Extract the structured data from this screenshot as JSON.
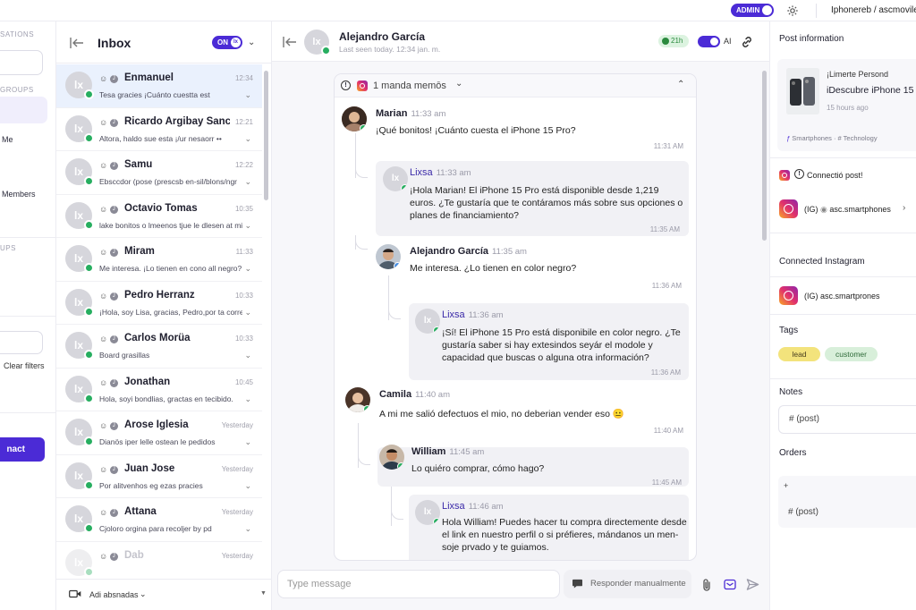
{
  "topbar": {
    "admin_label": "ADMIN",
    "account_label": "Iphonereb / ascmoviles",
    "gear_icon": "gear-icon"
  },
  "leftnav": {
    "section_conversations": "SATIONS",
    "section_groups": "GROUPS",
    "item_me": "Me",
    "item_members": "Members",
    "section_ups": "UPS",
    "clear_filters": "Clear filters",
    "cta_label": "nact"
  },
  "inbox": {
    "title": "Inbox",
    "toggle_label": "ON",
    "toggle_knob": "lx",
    "footer_label": "Adi absnadas",
    "conversations": [
      {
        "name": "Enmanuel",
        "time": "12:34",
        "preview": "Tesa gracies ¡Cuánto cuestta est",
        "active": true
      },
      {
        "name": "Ricardo Argibay Sanc...",
        "time": "12:21",
        "preview": "Altora, haldo sue esta ¡/ur nesaorr ••",
        "active": false
      },
      {
        "name": "Samu",
        "time": "12:22",
        "preview": "Ebsccdor (pose (prescsb en-sil/blons/ngr",
        "active": false
      },
      {
        "name": "Octavio Tomas",
        "time": "10:35",
        "preview": "lake bonitos o lmeenos tjue le dlesen at mi",
        "active": false
      },
      {
        "name": "Miram",
        "time": "11:33",
        "preview": "Me interesa. ¡Lo tienen en cono all negro?",
        "active": false
      },
      {
        "name": "Pedro Herranz",
        "time": "10:33",
        "preview": "¡Hola, soy Lisa, gracias, Pedro,por ta correos'",
        "active": false
      },
      {
        "name": "Carlos Morüa",
        "time": "10:33",
        "preview": "Board grasillas",
        "active": false
      },
      {
        "name": "Jonathan",
        "time": "10:45",
        "preview": "Hola, soyi bondlias, gractas en tecibido.",
        "active": false
      },
      {
        "name": "Arose Iglesia",
        "time": "Yesterday",
        "preview": "Dianös iper lelle ostean le pedidos",
        "active": false
      },
      {
        "name": "Juan Jose",
        "time": "Yesterday",
        "preview": "Por alitvenhos eg ezas pracies",
        "active": false
      },
      {
        "name": "Attana",
        "time": "Yesterday",
        "preview": "Cjoloro orgina para recoljer by pd",
        "active": false
      },
      {
        "name": "Dab",
        "time": "Yesterday",
        "preview": "",
        "active": false
      }
    ]
  },
  "chat": {
    "contact_name": "Alejandro García",
    "last_seen": "Last seen today. 12:34 jan. m.",
    "timer": "21h",
    "ai_label": "AI",
    "thread_title": "1 manda memōs",
    "composer_placeholder": "Type message",
    "manual_label": "Responder manualmente",
    "messages": [
      {
        "author": "Marian",
        "time": "11:33 am",
        "text": "¡Qué bonitos! ¡Cuánto cuesta el iPhone 15 Pro?",
        "footer": "11:31 AM"
      },
      {
        "author": "Lixsa",
        "time": "11:33 am",
        "text": "¡Hola Marian! El iPhone 15 Pro está disponible desde 1,219 euros. ¿Te gustaría que te contáramos más sobre sus opciones o planes de financiamiento?",
        "footer": "11:35 AM"
      },
      {
        "author": "Alejandro García",
        "time": "11:35 am",
        "text": "Me interesa. ¿Lo tienen en color negro?",
        "footer": "11:36 AM"
      },
      {
        "author": "Lixsa",
        "time": "11:36 am",
        "text": "¡Sí! El iPhone 15 Pro está disponibile en color negro. ¿Te gustaría saber si hay extesindos seyár el modole y capacidad que buscas o alguna otra información?",
        "footer": "11:36 AM"
      },
      {
        "author": "Camila",
        "time": "11:40 am",
        "text": "A mi me salió defectuos el mio, no deberian vender eso",
        "footer": "11:40 AM"
      },
      {
        "author": "William",
        "time": "11:45 am",
        "text": "Lo quiéro comprar, cómo hago?",
        "footer": "11:45 AM"
      },
      {
        "author": "Lixsa",
        "time": "11:46 am",
        "text": "Hola William! Puedes hacer tu compra directemente desde el link en nuestro perfil o si préfieres, mándanos un men-soje prvado y te guiamos.",
        "footer": ""
      }
    ]
  },
  "panel": {
    "post_info_title": "Post information",
    "post_author": "¡Limerte Persond",
    "post_title": "iDescubre iPhone 15",
    "post_age": "15 hours ago",
    "post_tags": "Smartphones · # Technology",
    "connected_post_label": "Connectió post!",
    "account1_prefix": "(IG)",
    "account1_handle": "asc.smartphones",
    "connected_instagram_title": "Connected Instagram",
    "account2_prefix": "(IG)",
    "account2_handle": "asc.smartprones",
    "tags_title": "Tags",
    "tags": [
      "lead",
      "customer"
    ],
    "notes_title": "Notes",
    "notes_placeholder": "# (post)",
    "orders_title": "Orders",
    "orders_plus": "+",
    "orders_placeholder": "# (post)"
  },
  "colors": {
    "accent": "#4b2bd6",
    "online": "#27ae60",
    "active_row": "#eaf1fd",
    "tag_lead": "#f3e37c",
    "tag_customer": "#d8efda"
  }
}
